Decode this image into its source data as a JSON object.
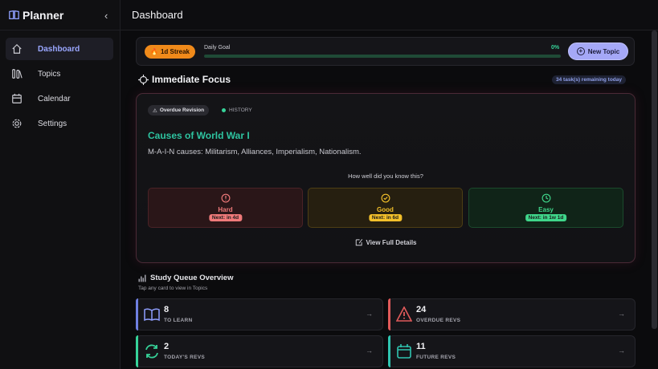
{
  "sidebar": {
    "title": "Planner",
    "collapse_glyph": "‹",
    "items": [
      {
        "label": "Dashboard",
        "icon": "home-icon",
        "active": true
      },
      {
        "label": "Topics",
        "icon": "books-icon"
      },
      {
        "label": "Calendar",
        "icon": "calendar-icon"
      },
      {
        "label": "Settings",
        "icon": "gear-icon"
      }
    ]
  },
  "header": {
    "title": "Dashboard"
  },
  "streak": {
    "label": "1d Streak",
    "icon": "flame-icon"
  },
  "goal": {
    "label": "Daily Goal",
    "percent_text": "0%",
    "progress": 0
  },
  "new_topic": {
    "label": "New Topic"
  },
  "focus": {
    "title": "Immediate Focus",
    "remaining": "34 task(s) remaining today",
    "badge": "Overdue Revision",
    "history": "HISTORY",
    "topic_title": "Causes of World War I",
    "topic_desc": "M-A-I-N causes: Militarism, Alliances, Imperialism, Nationalism.",
    "prompt": "How well did you know this?",
    "ratings": [
      {
        "label": "Hard",
        "next": "Next: in 4d",
        "color": "#f07a7a"
      },
      {
        "label": "Good",
        "next": "Next: in 6d",
        "color": "#f3c02a"
      },
      {
        "label": "Easy",
        "next": "Next: in 1w 1d",
        "color": "#3fd68a"
      }
    ],
    "details": "View Full Details"
  },
  "queue": {
    "title": "Study Queue Overview",
    "subtitle": "Tap any card to view in Topics",
    "cards": [
      {
        "count": "8",
        "label": "TO LEARN",
        "color": "#6f7fe0",
        "icon": "open-book-icon"
      },
      {
        "count": "24",
        "label": "OVERDUE REVS",
        "color": "#e05a5a",
        "icon": "warning-icon"
      },
      {
        "count": "2",
        "label": "TODAY'S REVS",
        "color": "#36d399",
        "icon": "refresh-icon"
      },
      {
        "count": "11",
        "label": "FUTURE REVS",
        "color": "#2fc4b0",
        "icon": "calendar-icon"
      }
    ]
  }
}
